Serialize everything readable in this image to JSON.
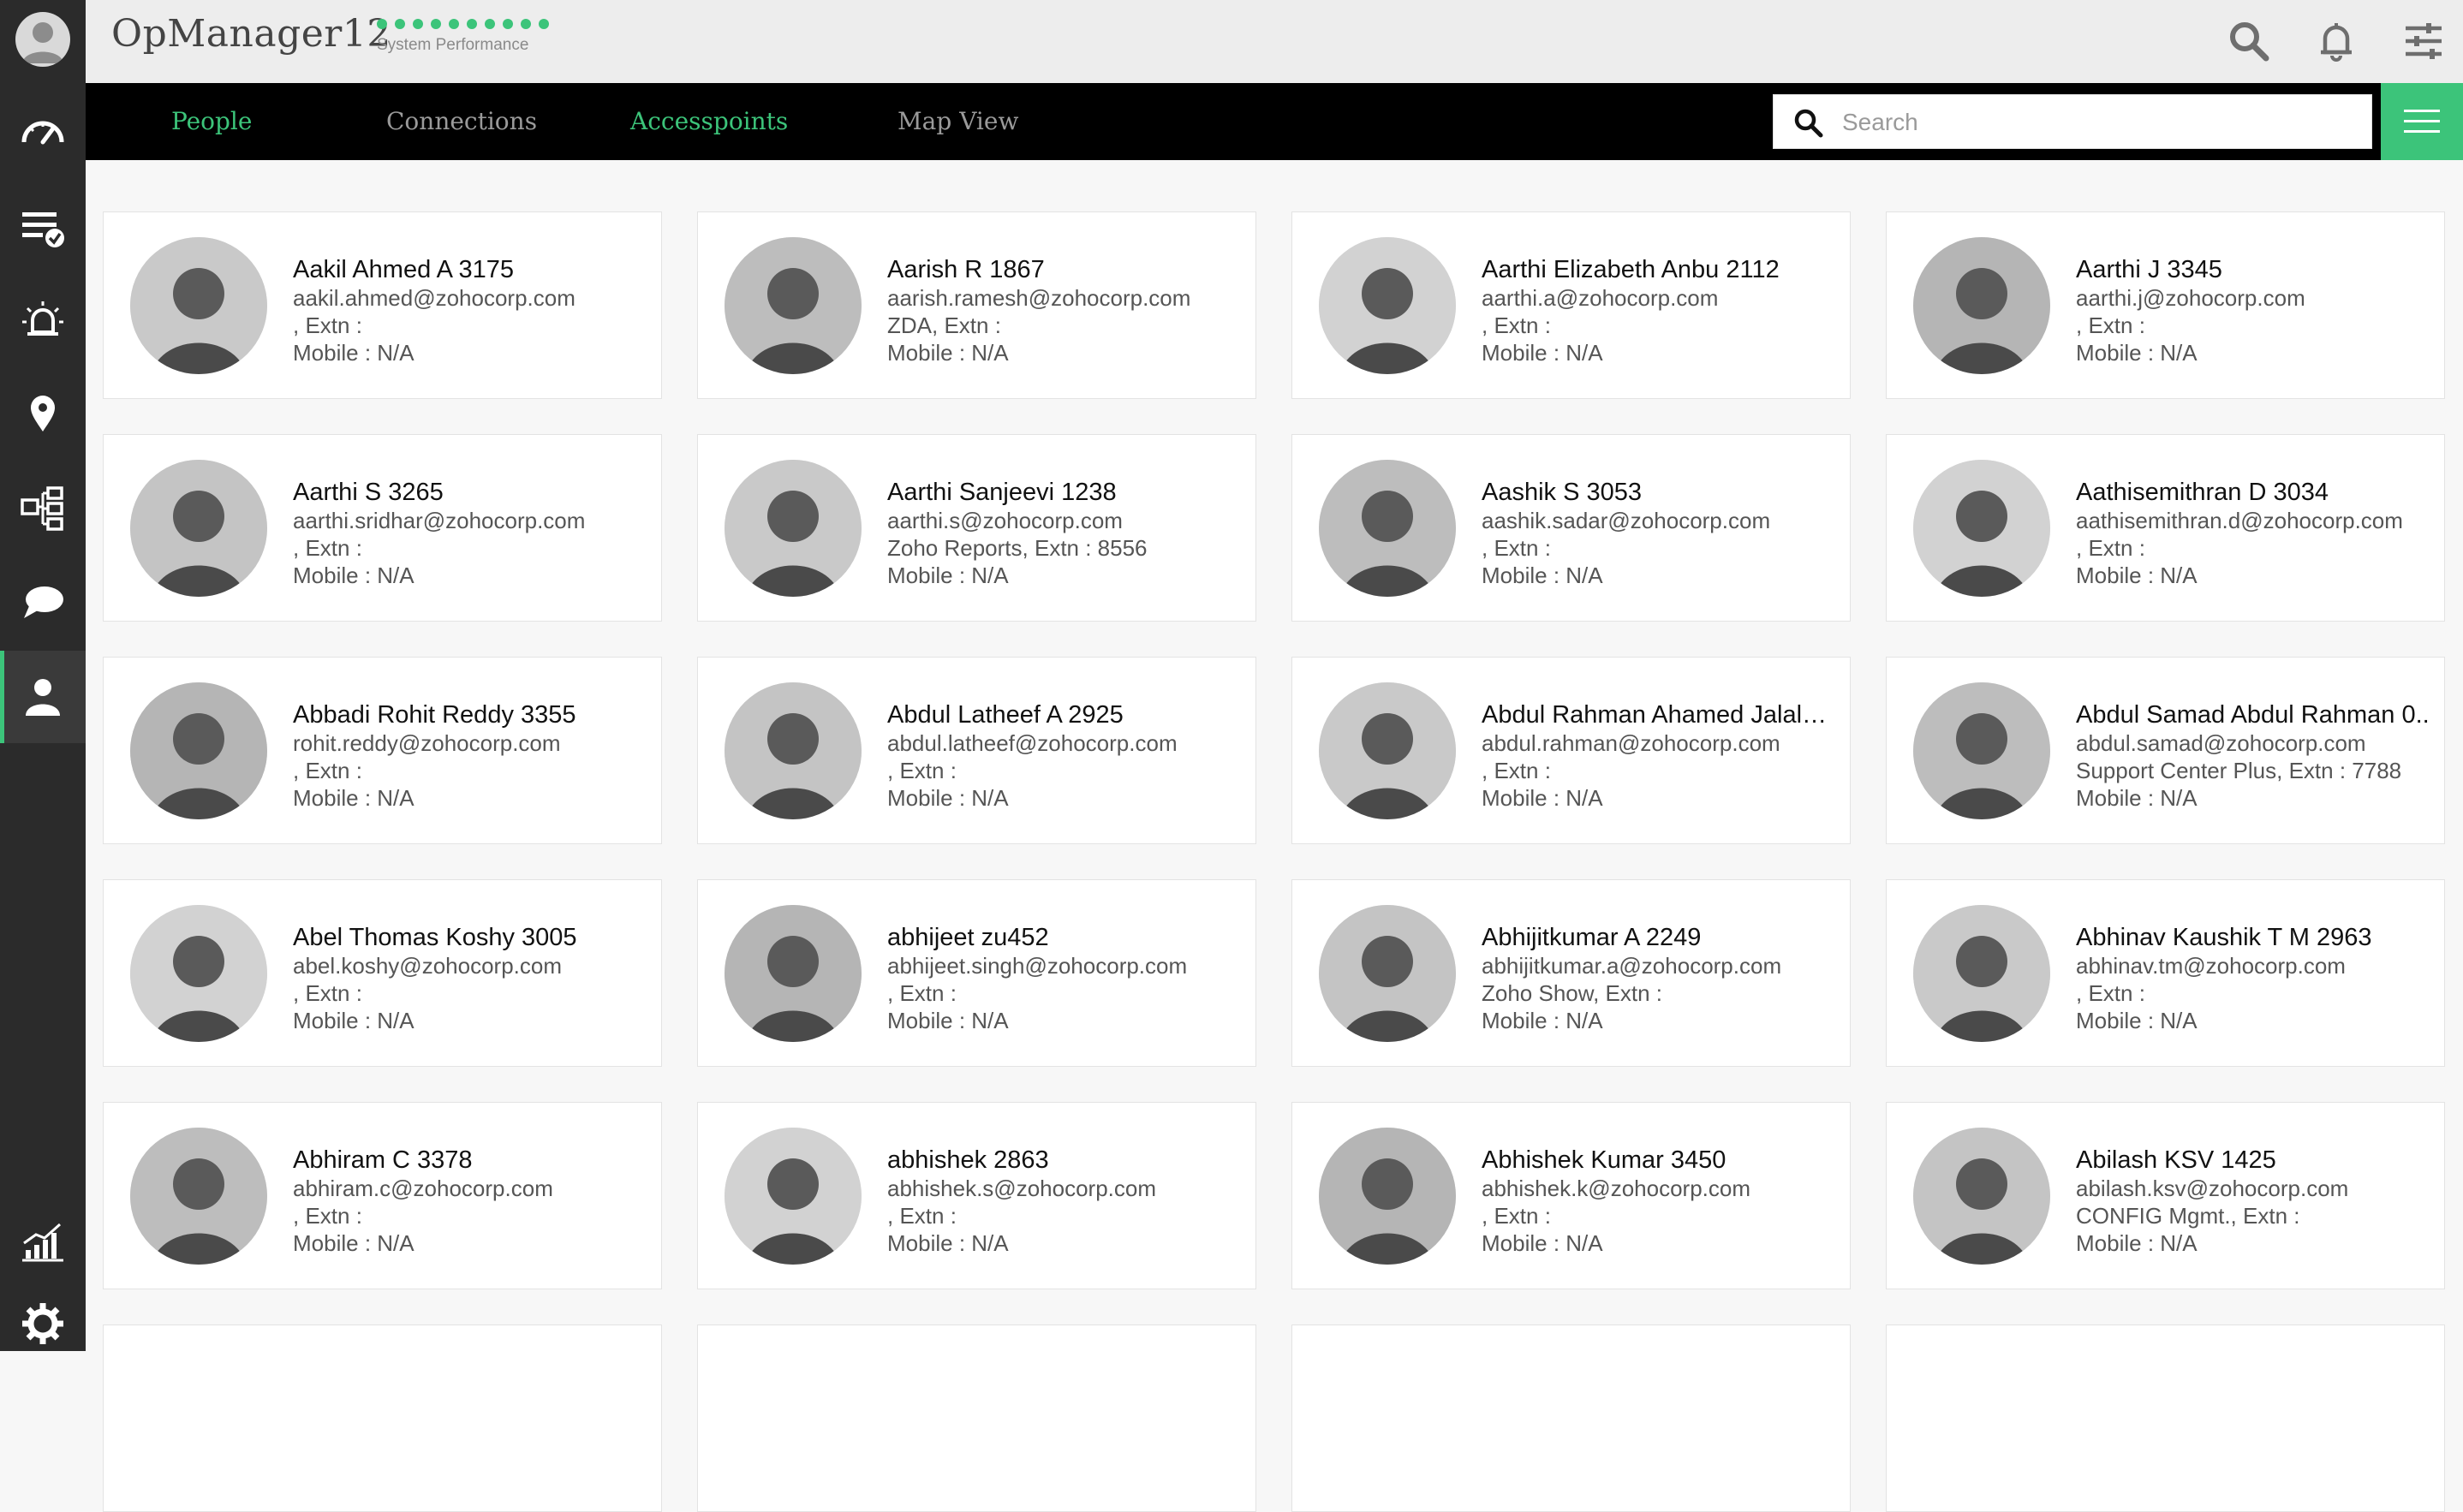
{
  "app": {
    "title": "OpManager12",
    "performance_label": "System Performance"
  },
  "colors": {
    "accent": "#3cc47a",
    "sidebar": "#2b2b2b",
    "tabbar": "#000000"
  },
  "header_icons": [
    "search-icon",
    "bell-icon",
    "sliders-icon"
  ],
  "sidebar": {
    "items": [
      {
        "icon": "dashboard-gauge-icon"
      },
      {
        "icon": "inventory-list-icon"
      },
      {
        "icon": "alarm-icon"
      },
      {
        "icon": "map-pin-icon"
      },
      {
        "icon": "workflow-icon"
      },
      {
        "icon": "chat-icon"
      },
      {
        "icon": "people-icon",
        "active": true
      },
      {
        "icon": "reports-chart-icon"
      },
      {
        "icon": "settings-gear-icon"
      }
    ]
  },
  "tabs": [
    {
      "label": "People",
      "highlight": true
    },
    {
      "label": "Connections",
      "highlight": false
    },
    {
      "label": "Accesspoints",
      "highlight": true
    },
    {
      "label": "Map View",
      "highlight": false
    }
  ],
  "search": {
    "placeholder": "Search",
    "value": ""
  },
  "people": [
    {
      "name": "Aakil Ahmed A 3175",
      "email": "aakil.ahmed@zohocorp.com",
      "dept": ", Extn :",
      "mobile": "Mobile : N/A"
    },
    {
      "name": "Aarish R 1867",
      "email": "aarish.ramesh@zohocorp.com",
      "dept": "ZDA, Extn :",
      "mobile": "Mobile : N/A"
    },
    {
      "name": "Aarthi Elizabeth Anbu 2112",
      "email": "aarthi.a@zohocorp.com",
      "dept": ", Extn :",
      "mobile": "Mobile : N/A"
    },
    {
      "name": "Aarthi J 3345",
      "email": "aarthi.j@zohocorp.com",
      "dept": ", Extn :",
      "mobile": "Mobile : N/A"
    },
    {
      "name": "Aarthi S 3265",
      "email": "aarthi.sridhar@zohocorp.com",
      "dept": ", Extn :",
      "mobile": "Mobile : N/A"
    },
    {
      "name": "Aarthi Sanjeevi 1238",
      "email": "aarthi.s@zohocorp.com",
      "dept": "Zoho Reports, Extn : 8556",
      "mobile": "Mobile : N/A"
    },
    {
      "name": "Aashik S 3053",
      "email": "aashik.sadar@zohocorp.com",
      "dept": ", Extn :",
      "mobile": "Mobile : N/A"
    },
    {
      "name": "Aathisemithran D 3034",
      "email": "aathisemithran.d@zohocorp.com",
      "dept": ", Extn :",
      "mobile": "Mobile : N/A"
    },
    {
      "name": "Abbadi Rohit Reddy 3355",
      "email": "rohit.reddy@zohocorp.com",
      "dept": ", Extn :",
      "mobile": "Mobile : N/A"
    },
    {
      "name": "Abdul Latheef A 2925",
      "email": "abdul.latheef@zohocorp.com",
      "dept": ", Extn :",
      "mobile": "Mobile : N/A"
    },
    {
      "name": "Abdul Rahman Ahamed Jalalu...",
      "email": "abdul.rahman@zohocorp.com",
      "dept": ", Extn :",
      "mobile": "Mobile : N/A"
    },
    {
      "name": "Abdul Samad Abdul Rahman 0..",
      "email": "abdul.samad@zohocorp.com",
      "dept": "Support Center Plus, Extn : 7788",
      "mobile": "Mobile : N/A"
    },
    {
      "name": "Abel Thomas Koshy 3005",
      "email": "abel.koshy@zohocorp.com",
      "dept": ", Extn :",
      "mobile": "Mobile : N/A"
    },
    {
      "name": "abhijeet zu452",
      "email": "abhijeet.singh@zohocorp.com",
      "dept": ", Extn :",
      "mobile": "Mobile : N/A"
    },
    {
      "name": "Abhijitkumar A 2249",
      "email": "abhijitkumar.a@zohocorp.com",
      "dept": "Zoho Show, Extn :",
      "mobile": "Mobile : N/A"
    },
    {
      "name": "Abhinav Kaushik T M 2963",
      "email": "abhinav.tm@zohocorp.com",
      "dept": ", Extn :",
      "mobile": "Mobile : N/A"
    },
    {
      "name": "Abhiram C 3378",
      "email": "abhiram.c@zohocorp.com",
      "dept": ", Extn :",
      "mobile": "Mobile : N/A"
    },
    {
      "name": "abhishek 2863",
      "email": "abhishek.s@zohocorp.com",
      "dept": ", Extn :",
      "mobile": "Mobile : N/A"
    },
    {
      "name": "Abhishek Kumar 3450",
      "email": "abhishek.k@zohocorp.com",
      "dept": ", Extn :",
      "mobile": "Mobile : N/A"
    },
    {
      "name": "Abilash KSV 1425",
      "email": "abilash.ksv@zohocorp.com",
      "dept": "CONFIG Mgmt., Extn :",
      "mobile": "Mobile : N/A"
    }
  ]
}
